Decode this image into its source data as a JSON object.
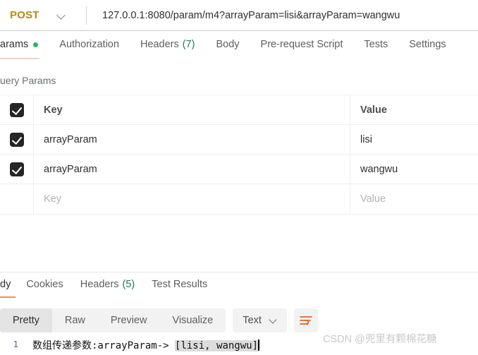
{
  "request": {
    "method": "POST",
    "url": "127.0.0.1:8080/param/m4?arrayParam=lisi&arrayParam=wangwu",
    "tabs": [
      {
        "label": "arams",
        "active": true,
        "dot": true
      },
      {
        "label": "Authorization",
        "active": false
      },
      {
        "label": "Headers",
        "count": "(7)",
        "active": false
      },
      {
        "label": "Body",
        "active": false
      },
      {
        "label": "Pre-request Script",
        "active": false
      },
      {
        "label": "Tests",
        "active": false
      },
      {
        "label": "Settings",
        "active": false
      }
    ],
    "params_section_title": "uery Params",
    "table": {
      "headers": {
        "key": "Key",
        "value": "Value"
      },
      "rows": [
        {
          "checked": true,
          "key": "arrayParam",
          "value": "lisi"
        },
        {
          "checked": true,
          "key": "arrayParam",
          "value": "wangwu"
        }
      ],
      "placeholder_row": {
        "key": "Key",
        "value": "Value"
      }
    }
  },
  "response": {
    "tabs": [
      {
        "label": "dy",
        "active": true
      },
      {
        "label": "Cookies",
        "active": false
      },
      {
        "label": "Headers",
        "count": "(5)",
        "active": false
      },
      {
        "label": "Test Results",
        "active": false
      }
    ],
    "format_buttons": [
      {
        "label": "Pretty",
        "active": true
      },
      {
        "label": "Raw",
        "active": false
      },
      {
        "label": "Preview",
        "active": false
      },
      {
        "label": "Visualize",
        "active": false
      }
    ],
    "type_selector": "Text",
    "body": {
      "line_number": "1",
      "text_prefix": "数组传递参数:arrayParam-> ",
      "text_selected": "[lisi, wangwu]"
    }
  },
  "watermark": "CSDN @兜里有颗棉花糖",
  "colors": {
    "method": "#b58b0d",
    "accent_orange": "#f08d4d",
    "green_dot": "#29b860",
    "count_green": "#1a7f5a",
    "checkbox": "#252525"
  }
}
